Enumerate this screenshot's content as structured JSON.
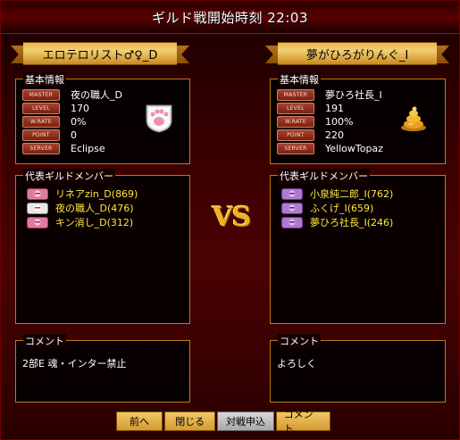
{
  "title": "ギルド戦開始時刻 22:03",
  "left": {
    "guild_name": "エロテロリスト♂♀_D",
    "info_caption": "基本情報",
    "stats": [
      {
        "badge": "MASTER",
        "value": "夜の職人_D"
      },
      {
        "badge": "LEVEL",
        "value": "170"
      },
      {
        "badge": "W.RATE",
        "value": "0%"
      },
      {
        "badge": "POINT",
        "value": "0"
      },
      {
        "badge": "SERVER",
        "value": "Eclipse"
      }
    ],
    "emblem_icon": "paw-print-icon",
    "members_caption": "代表ギルドメンバー",
    "members": [
      {
        "name": "リネアzin_D(869)",
        "icon": "pink-character-icon",
        "color": "#e07aa0"
      },
      {
        "name": "夜の職人_D(476)",
        "icon": "white-character-icon",
        "color": "#e8e8e8"
      },
      {
        "name": "キン消し_D(312)",
        "icon": "pink-character-icon",
        "color": "#e07aa0"
      }
    ],
    "comment_caption": "コメント",
    "comment": "2部E 魂・インター禁止"
  },
  "right": {
    "guild_name": "夢がひろがりんぐ_I",
    "info_caption": "基本情報",
    "stats": [
      {
        "badge": "MASTER",
        "value": "夢ひろ社長_I"
      },
      {
        "badge": "LEVEL",
        "value": "191"
      },
      {
        "badge": "W.RATE",
        "value": "100%"
      },
      {
        "badge": "POINT",
        "value": "220"
      },
      {
        "badge": "SERVER",
        "value": "YellowTopaz"
      }
    ],
    "emblem_icon": "golden-swirl-icon",
    "members_caption": "代表ギルドメンバー",
    "members": [
      {
        "name": "小泉純二郎_I(762)",
        "icon": "purple-character-icon",
        "color": "#b07ad0"
      },
      {
        "name": "ふくげ_I(659)",
        "icon": "purple-character-icon",
        "color": "#b07ad0"
      },
      {
        "name": "夢ひろ社長_I(246)",
        "icon": "purple-character-icon",
        "color": "#b07ad0"
      }
    ],
    "comment_caption": "コメント",
    "comment": "よろしく"
  },
  "vs_label": "VS",
  "buttons": {
    "prev": "前へ",
    "close": "閉じる",
    "apply": "対戦申込",
    "comment": "コメント"
  },
  "colors": {
    "accent_gold": "#f0b020",
    "member_text": "#ffe640",
    "panel_border": "#c07a18"
  }
}
